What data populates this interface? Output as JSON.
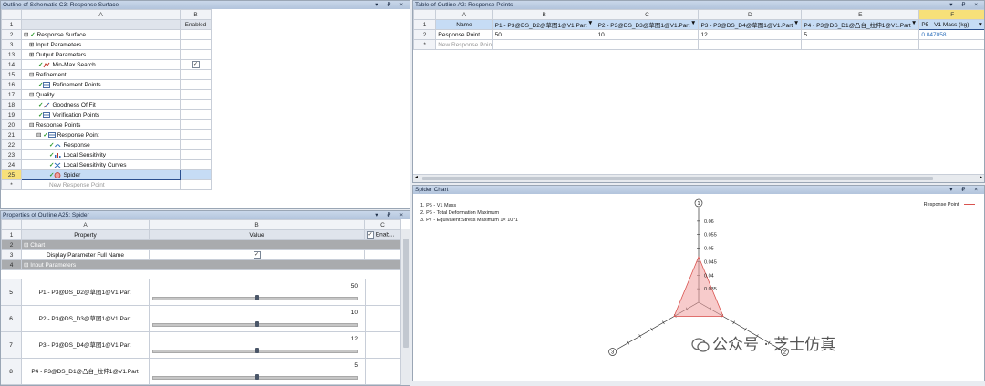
{
  "schematic": {
    "title": "Outline of Schematic C3: Response Surface",
    "col_a": "A",
    "col_b": "B",
    "enabled_header": "Enabled",
    "rows": [
      {
        "num": "1",
        "label": "",
        "enabled": ""
      },
      {
        "num": "2",
        "label": "Response Surface",
        "enabled": ""
      },
      {
        "num": "3",
        "label": "Input Parameters",
        "enabled": ""
      },
      {
        "num": "13",
        "label": "Output Parameters",
        "enabled": ""
      },
      {
        "num": "14",
        "label": "Min-Max Search",
        "enabled": "check"
      },
      {
        "num": "15",
        "label": "Refinement",
        "enabled": ""
      },
      {
        "num": "16",
        "label": "Refinement Points",
        "enabled": ""
      },
      {
        "num": "17",
        "label": "Quality",
        "enabled": ""
      },
      {
        "num": "18",
        "label": "Goodness Of Fit",
        "enabled": ""
      },
      {
        "num": "19",
        "label": "Verification Points",
        "enabled": ""
      },
      {
        "num": "20",
        "label": "Response Points",
        "enabled": ""
      },
      {
        "num": "21",
        "label": "Response Point",
        "enabled": ""
      },
      {
        "num": "22",
        "label": "Response",
        "enabled": ""
      },
      {
        "num": "23",
        "label": "Local Sensitivity",
        "enabled": ""
      },
      {
        "num": "24",
        "label": "Local Sensitivity Curves",
        "enabled": ""
      },
      {
        "num": "25",
        "label": "Spider",
        "enabled": ""
      }
    ],
    "new_row_label": "New Response Point"
  },
  "properties": {
    "title": "Properties of Outline A25: Spider",
    "col_a": "A",
    "col_b": "B",
    "col_c": "C",
    "property_header": "Property",
    "value_header": "Value",
    "enabled_header": "Enab...",
    "chart_section": "Chart",
    "display_full_name_label": "Display Parameter Full Name",
    "input_section": "Input Parameters",
    "params": [
      {
        "num": "5",
        "label": "P1 - P3@DS_D2@草图1@V1.Part",
        "value": "50",
        "fraction": 0.5
      },
      {
        "num": "6",
        "label": "P2 - P3@DS_D3@草图1@V1.Part",
        "value": "10",
        "fraction": 0.5
      },
      {
        "num": "7",
        "label": "P3 - P3@DS_D4@草图1@V1.Part",
        "value": "12",
        "fraction": 0.5
      },
      {
        "num": "8",
        "label": "P4 - P3@DS_D1@凸台_拉伸1@V1.Part",
        "value": "5",
        "fraction": 0.5
      }
    ]
  },
  "rp_table": {
    "title": "Table of Outline A2: Response Points",
    "cols": [
      "A",
      "B",
      "C",
      "D",
      "E",
      "F"
    ],
    "headers": [
      "Name",
      "P1 - P3@DS_D2@草图1@V1.Part",
      "P2 - P3@DS_D3@草图1@V1.Part",
      "P3 - P3@DS_D4@草图1@V1.Part",
      "P4 - P3@DS_D1@凸台_拉伸1@V1.Part",
      "P5 - V1 Mass (kg)"
    ],
    "row2": [
      "Response Point",
      "50",
      "10",
      "12",
      "5",
      "0.047058"
    ],
    "new_row_label": "New Response Point"
  },
  "spider": {
    "title": "Spider Chart",
    "legend_lines": [
      "1. P5 - V1 Mass",
      "2. P6 - Total Deformation Maximum",
      "3. P7 - Equivalent Stress Maximum  1× 10^1"
    ],
    "series_label": "Response Point",
    "axis_labels": [
      "1",
      "2",
      "3"
    ],
    "ticks": [
      "0.06",
      "0.055",
      "0.05",
      "0.045",
      "0.04",
      "0.035"
    ]
  },
  "watermark": "公众号 · 芝士仿真",
  "colors": {
    "title_bar": "#b2c4dc",
    "selection": "#c6dcf5",
    "section_gray": "#a9abae",
    "spider_fill": "#f0a0a0",
    "spider_stroke": "#d9534f"
  }
}
